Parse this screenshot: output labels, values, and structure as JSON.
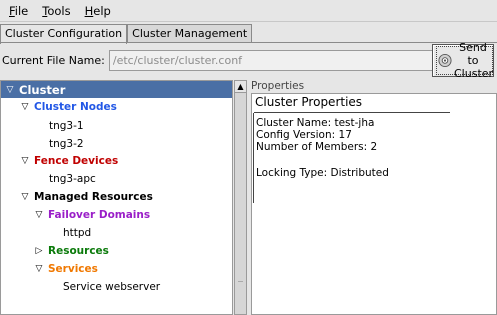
{
  "menu": [
    "File",
    "Tools",
    "Help"
  ],
  "tabs": [
    "Cluster Configuration",
    "Cluster Management"
  ],
  "file": {
    "label": "Current File Name:",
    "value": "/etc/cluster/cluster.conf"
  },
  "send_button": {
    "line1": "Send to",
    "line2": "Cluster",
    "icon": "cluster-send-icon"
  },
  "tree": {
    "root": "Cluster",
    "cluster_nodes": "Cluster Nodes",
    "nodes": [
      "tng3-1",
      "tng3-2"
    ],
    "fence_devices": "Fence Devices",
    "fence_items": [
      "tng3-apc"
    ],
    "managed_resources": "Managed Resources",
    "failover_domains": "Failover Domains",
    "failover_items": [
      "httpd"
    ],
    "resources": "Resources",
    "services": "Services",
    "service_items": [
      "Service webserver"
    ]
  },
  "properties": {
    "section_label": "Properties",
    "title": "Cluster Properties",
    "cluster_name": "Cluster Name: test-jha",
    "config_version": "Config Version: 17",
    "members": "Number of Members: 2",
    "locking": "Locking Type: Distributed"
  },
  "colors": {
    "tree_header": "#4a6fa5",
    "cluster_nodes": "#2257e6",
    "fence_devices": "#c00000",
    "failover_domains": "#9a1ec8",
    "resources": "#0a7a0a",
    "services": "#f07800"
  }
}
